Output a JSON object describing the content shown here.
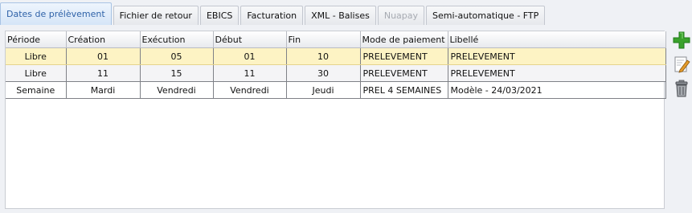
{
  "tabs": [
    {
      "label": "Dates de prélèvement",
      "state": "active"
    },
    {
      "label": "Fichier de retour",
      "state": "normal"
    },
    {
      "label": "EBICS",
      "state": "normal"
    },
    {
      "label": "Facturation",
      "state": "normal"
    },
    {
      "label": "XML - Balises",
      "state": "normal"
    },
    {
      "label": "Nuapay",
      "state": "disabled"
    },
    {
      "label": "Semi-automatique - FTP",
      "state": "normal"
    }
  ],
  "table": {
    "columns": [
      "Période",
      "Création",
      "Exécution",
      "Début",
      "Fin",
      "Mode de paiement",
      "Libellé"
    ],
    "rows": [
      [
        "Libre",
        "01",
        "05",
        "01",
        "10",
        "PRELEVEMENT",
        "PRELEVEMENT"
      ],
      [
        "Libre",
        "11",
        "15",
        "11",
        "30",
        "PRELEVEMENT",
        "PRELEVEMENT"
      ],
      [
        "Semaine",
        "Mardi",
        "Vendredi",
        "Vendredi",
        "Jeudi",
        "PREL 4 SEMAINES",
        "Modèle - 24/03/2021"
      ]
    ],
    "selected_row": 0
  },
  "actions": [
    {
      "icon": "add-icon",
      "color": "#3aa22c"
    },
    {
      "icon": "edit-icon",
      "color": "#e39a2a"
    },
    {
      "icon": "trash-icon",
      "color": "#6f7378"
    }
  ]
}
